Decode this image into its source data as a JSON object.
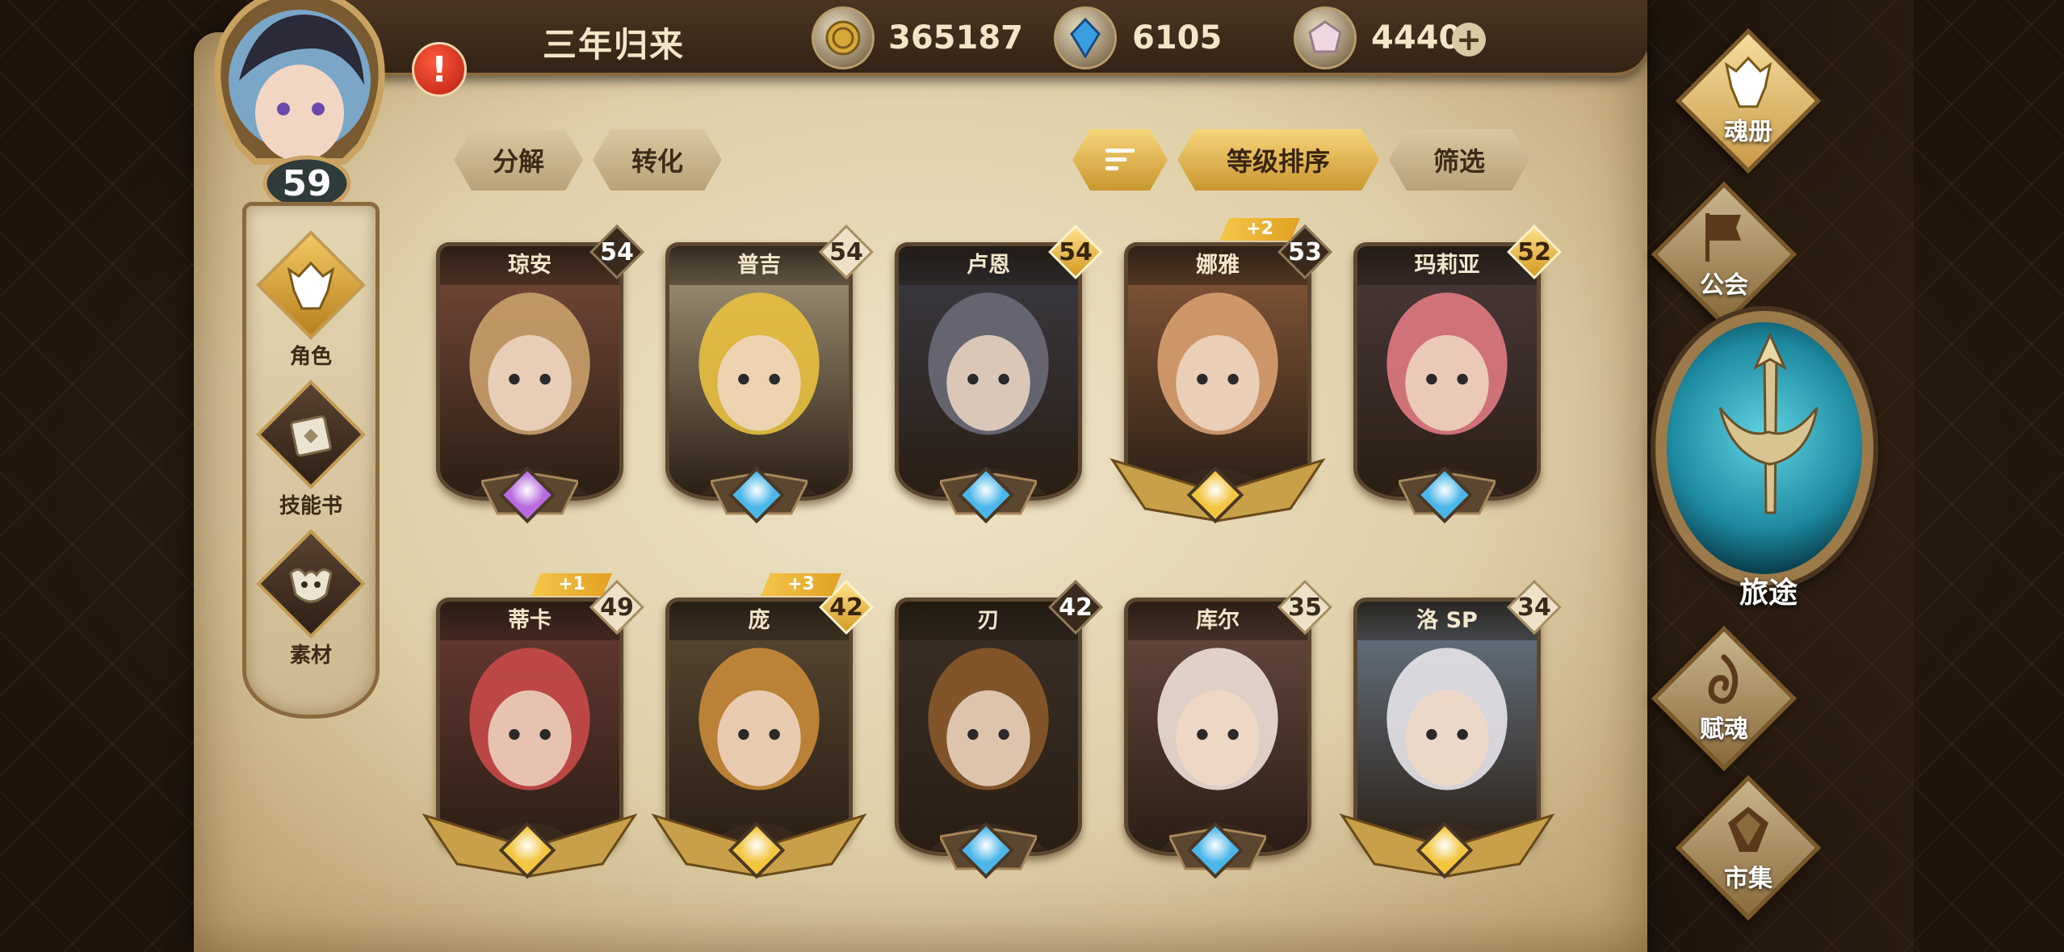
{
  "header": {
    "player_name": "三年归来",
    "gold": "365187",
    "crystal": "6105",
    "gem": "4440",
    "plus": "+"
  },
  "avatar": {
    "level": "59",
    "alert": "!"
  },
  "left_nav": {
    "items": [
      {
        "label": "角色",
        "icon": "helmet-icon"
      },
      {
        "label": "技能书",
        "icon": "book-icon"
      },
      {
        "label": "素材",
        "icon": "beast-icon"
      }
    ]
  },
  "toolbar": {
    "decompose": "分解",
    "convert": "转化",
    "sort_by_level": "等级排序",
    "filter": "筛选"
  },
  "cards": [
    {
      "name": "琼安",
      "level": "54",
      "badge": "dark",
      "plus": "",
      "gem": "purple",
      "winged": false,
      "bg": "#7a4a3a",
      "accent": "#c9a06a"
    },
    {
      "name": "普吉",
      "level": "54",
      "badge": "light",
      "plus": "",
      "gem": "blue",
      "winged": false,
      "bg": "#a89a7c",
      "accent": "#e8c040"
    },
    {
      "name": "卢恩",
      "level": "54",
      "badge": "gold",
      "plus": "",
      "gem": "blue",
      "winged": false,
      "bg": "#3a3a44",
      "accent": "#6a6a78"
    },
    {
      "name": "娜雅",
      "level": "53",
      "badge": "dark",
      "plus": "+2",
      "gem": "gold",
      "winged": true,
      "bg": "#8a5a3a",
      "accent": "#d8a070"
    },
    {
      "name": "玛莉亚",
      "level": "52",
      "badge": "gold",
      "plus": "",
      "gem": "blue",
      "winged": false,
      "bg": "#4a3a3a",
      "accent": "#e07a82"
    },
    {
      "name": "蒂卡",
      "level": "49",
      "badge": "light",
      "plus": "+1",
      "gem": "gold",
      "winged": true,
      "bg": "#6a3a34",
      "accent": "#c84a48"
    },
    {
      "name": "庞",
      "level": "42",
      "badge": "gold",
      "plus": "+3",
      "gem": "gold",
      "winged": true,
      "bg": "#5a4a34",
      "accent": "#c88a3a"
    },
    {
      "name": "刃",
      "level": "42",
      "badge": "dark",
      "plus": "",
      "gem": "blue",
      "winged": false,
      "bg": "#3a3028",
      "accent": "#8a5a2a"
    },
    {
      "name": "库尔",
      "level": "35",
      "badge": "light",
      "plus": "",
      "gem": "blue",
      "winged": false,
      "bg": "#6a4a40",
      "accent": "#eee0d8"
    },
    {
      "name": "洛 SP",
      "level": "34",
      "badge": "light",
      "plus": "",
      "gem": "gold",
      "winged": true,
      "bg": "#6a7a8a",
      "accent": "#e8e4ea"
    }
  ],
  "right_menu": {
    "soul_book": "魂册",
    "guild": "公会",
    "journey": "旅途",
    "endow_soul": "赋魂",
    "market": "市集"
  },
  "colors": {
    "gold_accent": "#d49a22",
    "gem_blue": "#4ab6ea",
    "gem_purple": "#b86ae0",
    "journey_teal": "#1d8aa0"
  }
}
